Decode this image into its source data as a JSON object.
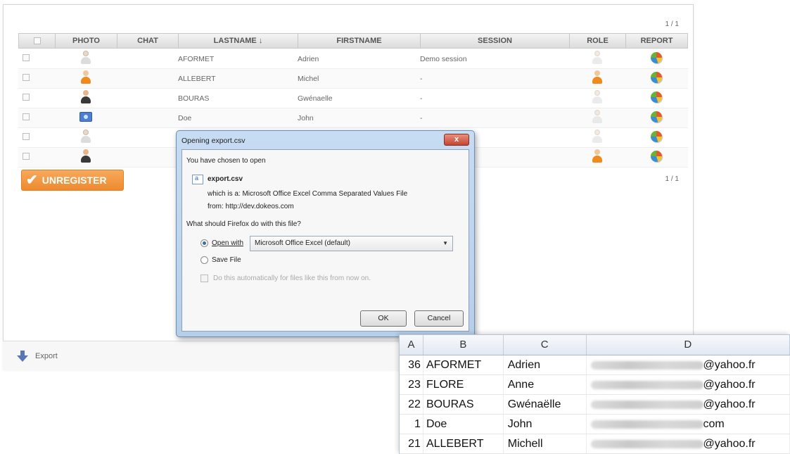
{
  "table": {
    "page_indicator_top": "1 / 1",
    "page_indicator_bottom": "1 / 1",
    "columns": [
      "PHOTO",
      "CHAT",
      "LASTNAME",
      "FIRSTNAME",
      "SESSION",
      "ROLE",
      "REPORT"
    ],
    "sort_indicator": "↓",
    "rows": [
      {
        "lastname": "AFORMET",
        "firstname": "Adrien",
        "session": "Demo session",
        "photo": "user-gray-icon",
        "role": "user-gray-icon"
      },
      {
        "lastname": "ALLEBERT",
        "firstname": "Michel",
        "session": "-",
        "photo": "user-orange-icon",
        "role": "user-orange-icon"
      },
      {
        "lastname": "BOURAS",
        "firstname": "Gwénaelle",
        "session": "-",
        "photo": "user-dark-icon",
        "role": "user-gray-icon"
      },
      {
        "lastname": "Doe",
        "firstname": "John",
        "session": "-",
        "photo": "camera-icon",
        "role": "user-gray-icon"
      },
      {
        "lastname": "",
        "firstname": "",
        "session": "",
        "photo": "user-gray-icon",
        "role": "user-gray-icon"
      },
      {
        "lastname": "",
        "firstname": "",
        "session": "",
        "photo": "user-dark-icon",
        "role": "user-orange-icon"
      }
    ]
  },
  "unregister_label": "UNREGISTER",
  "footer": {
    "export_label": "Export"
  },
  "dialog": {
    "title": "Opening export.csv",
    "close_label": "x",
    "chosen_text": "You have chosen to open",
    "filename": "export.csv",
    "which_is": "which is a:  Microsoft Office Excel Comma Separated Values File",
    "from": "from:  http://dev.dokeos.com",
    "question": "What should Firefox do with this file?",
    "open_with_label": "Open with",
    "open_with_value": "Microsoft Office Excel (default)",
    "save_file_label": "Save File",
    "auto_label": "Do this automatically for files like this from now on.",
    "ok_label": "OK",
    "cancel_label": "Cancel"
  },
  "spreadsheet": {
    "columns": [
      "A",
      "B",
      "C",
      "D"
    ],
    "rows": [
      {
        "a": "36",
        "b": "AFORMET",
        "c": "Adrien",
        "d": "@yahoo.fr"
      },
      {
        "a": "23",
        "b": "FLORE",
        "c": "Anne",
        "d": "@yahoo.fr"
      },
      {
        "a": "22",
        "b": "BOURAS",
        "c": "Gwénaëlle",
        "d": "@yahoo.fr"
      },
      {
        "a": "1",
        "b": "Doe",
        "c": "John",
        "d": "com"
      },
      {
        "a": "21",
        "b": "ALLEBERT",
        "c": "Michell",
        "d": "@yahoo.fr"
      }
    ]
  }
}
